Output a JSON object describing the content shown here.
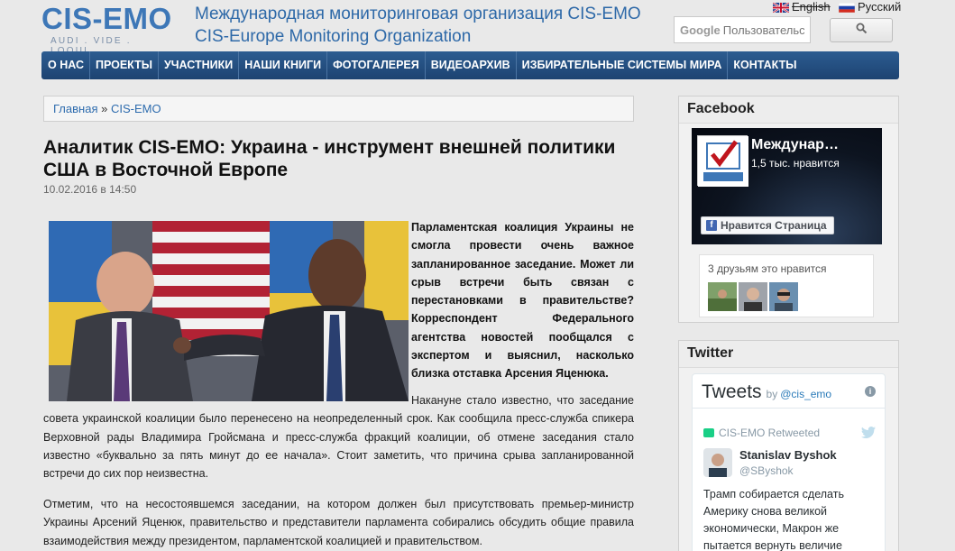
{
  "header": {
    "logo_text": "CIS-EMO",
    "logo_slogan": "AUDI . VIDE . LOQUI.",
    "org_name_ru": "Международная мониторинговая организация CIS-EMO",
    "org_name_en": "CIS-Europe Monitoring Organization",
    "lang_en": "English",
    "lang_ru": "Русский",
    "search_brand": "Google",
    "search_placeholder": "Пользовательский поиск"
  },
  "nav": {
    "items": [
      "О НАС",
      "ПРОЕКТЫ",
      "УЧАСТНИКИ",
      "НАШИ КНИГИ",
      "ФОТОГАЛЕРЕЯ",
      "ВИДЕОАРХИВ",
      "ИЗБИРАТЕЛЬНЫЕ СИСТЕМЫ МИРА",
      "КОНТАКТЫ"
    ]
  },
  "breadcrumb": {
    "home": "Главная",
    "separator": "»",
    "current": "CIS-EMO"
  },
  "article": {
    "title": "Аналитик CIS-EMO: Украина - инструмент внешней политики США в Восточной Европе",
    "date": "10.02.2016 в 14:50",
    "lead": "Парламентская коалиция Украины не смогла провести очень важное запланированное заседание. Может ли срыв встречи быть связан с перестановками в правительстве? Корреспондент Федерального агентства новостей пообщался с экспертом и выяснил, насколько близка отставка Арсения Яценюка.",
    "p1": "Накануне стало известно, что заседание совета украинской коалиции было перенесено на неопределенный срок. Как сообщила пресс-служба спикера Верховной рады Владимира Гройсмана и пресс-служба фракций коалиции, об отмене заседания стало известно «буквально за пять минут до ее начала». Стоит заметить, что причина срыва запланированной встречи до сих пор неизвестна.",
    "p2": "Отметим, что на несостоявшемся заседании, на котором должен был присутствовать премьер-министр Украины Арсений Яценюк, правительство и представители парламента собирались обсудить общие правила взаимодействия между президентом, парламентской коалицией и правительством."
  },
  "facebook": {
    "title": "Facebook",
    "page_name": "Междунар…",
    "likes": "1,5 тыс. нравится",
    "like_button": "Нравится Страница",
    "friends_text": "3 друзьям это нравится"
  },
  "twitter": {
    "title": "Twitter",
    "tweets_label": "Tweets",
    "by_label": "by",
    "handle": "@cis_emo",
    "retweeted": "CIS-EMO Retweeted",
    "author": "Stanislav Byshok",
    "author_handle": "@SByshok",
    "text": "Трамп собирается сделать Америку снова великой экономически, Макрон же пытается вернуть величие"
  }
}
